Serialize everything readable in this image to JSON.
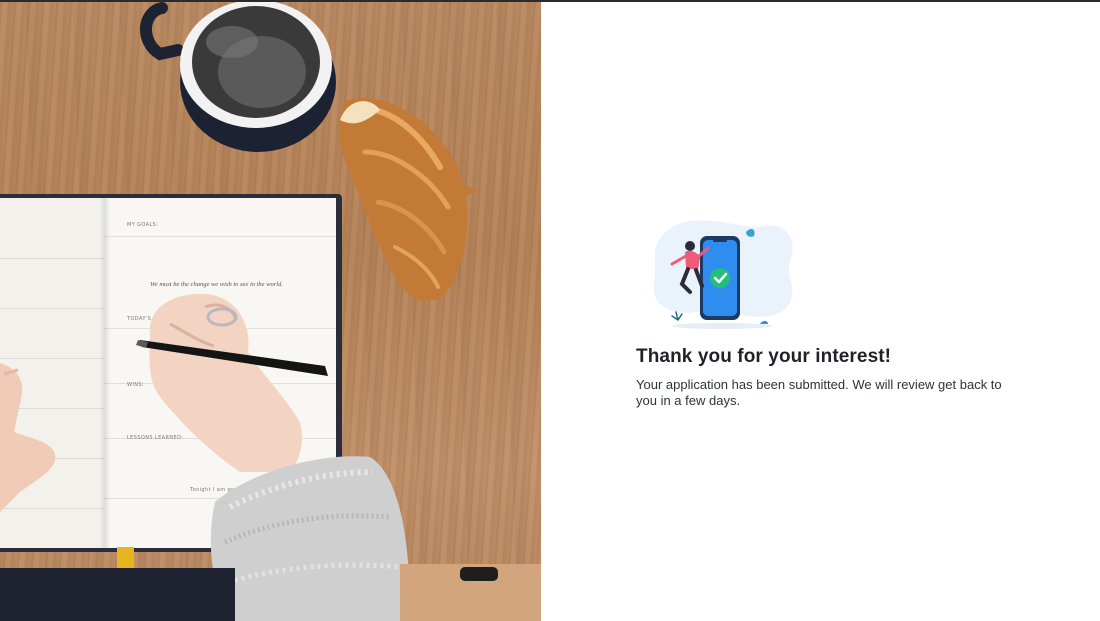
{
  "confirmation": {
    "heading": "Thank you for your interest!",
    "message": "Your application has been submitted. We will review get back to you in a few days."
  },
  "photo": {
    "subject": "desk-notebook-writing",
    "notebook": {
      "goals_label": "MY GOALS:",
      "quote": "We must be the change we wish to see in the world.",
      "targets_label": "TODAY'S TARGETS:",
      "wins_label": "WINS:",
      "lessons_label": "LESSONS LEARNED:",
      "gratitude_label": "Tonight I am grateful for..."
    }
  },
  "illustration": {
    "icon": "success-phone-illustration",
    "check_icon": "checkmark-icon"
  },
  "colors": {
    "heading": "#1f2329",
    "text": "#2e333a",
    "phone": "#2f8df0",
    "check": "#22c07a",
    "blob": "#eaf2fb"
  }
}
